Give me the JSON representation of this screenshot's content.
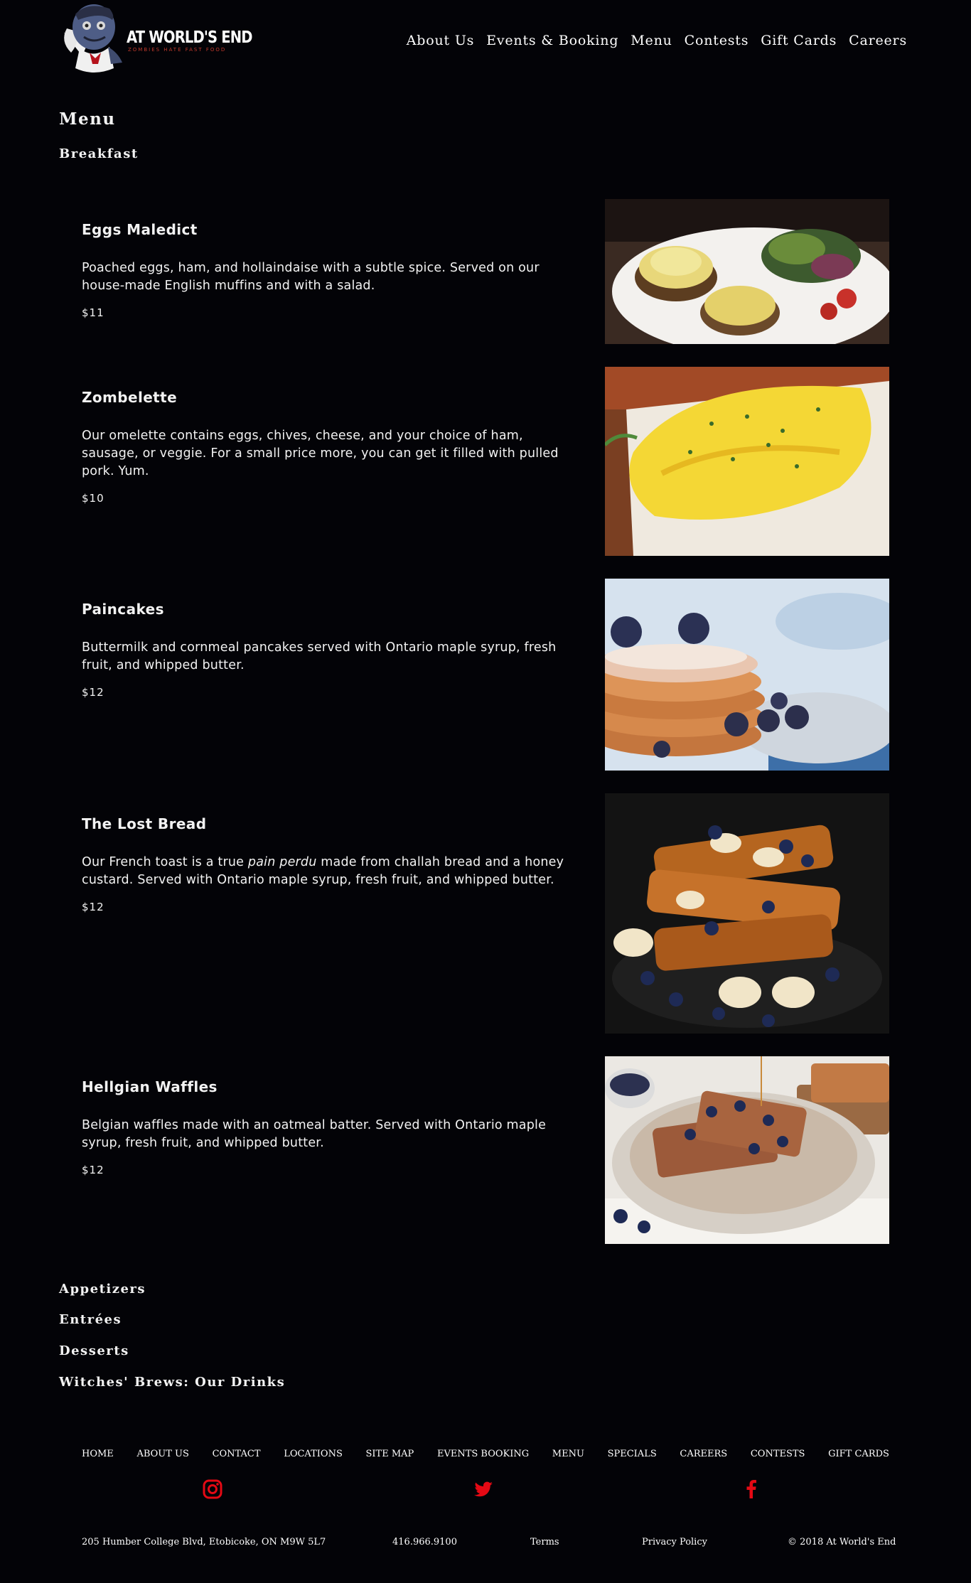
{
  "brand": {
    "name": "AT WORLD'S END",
    "tagline": "ZOMBIES HATE FAST FOOD"
  },
  "nav": [
    "About Us",
    "Events & Booking",
    "Menu",
    "Contests",
    "Gift Cards",
    "Careers"
  ],
  "page": {
    "title": "Menu",
    "section": "Breakfast"
  },
  "items": [
    {
      "name": "Eggs Maledict",
      "desc": "Poached eggs, ham, and hollaindaise with a subtle spice. Served on our house-made English muffins and with a salad.",
      "price": "$11",
      "image": "eggs-benedict-photo"
    },
    {
      "name": "Zombelette",
      "desc": "Our omelette contains eggs, chives, cheese, and your choice of ham, sausage, or veggie. For a small price more, you can get it filled with pulled pork. Yum.",
      "price": "$10",
      "image": "omelette-photo"
    },
    {
      "name": "Paincakes",
      "desc": "Buttermilk and cornmeal pancakes served with Ontario maple syrup, fresh fruit, and whipped butter.",
      "price": "$12",
      "image": "pancakes-photo"
    },
    {
      "name": "The Lost Bread",
      "desc_before": "Our French toast is a true ",
      "desc_italic": "pain perdu",
      "desc_after": " made from challah bread and a honey custard. Served with Ontario maple syrup, fresh fruit, and whipped butter.",
      "price": "$12",
      "image": "french-toast-photo"
    },
    {
      "name": "Hellgian Waffles",
      "desc": "Belgian waffles made with an oatmeal batter. Served with Ontario maple syrup, fresh fruit, and whipped butter.",
      "price": "$12",
      "image": "waffles-photo"
    }
  ],
  "categories": [
    "Appetizers",
    "Entrées",
    "Desserts",
    "Witches' Brews: Our Drinks"
  ],
  "footer": {
    "links": [
      "HOME",
      "ABOUT US",
      "CONTACT",
      "LOCATIONS",
      "SITE MAP",
      "EVENTS BOOKING",
      "MENU",
      "SPECIALS",
      "CAREERS",
      "CONTESTS",
      "GIFT CARDS"
    ],
    "social": [
      "instagram-icon",
      "twitter-icon",
      "facebook-icon"
    ],
    "address": "205 Humber College Blvd, Etobicoke, ON M9W 5L7",
    "phone": "416.966.9100",
    "terms": "Terms",
    "privacy": "Privacy Policy",
    "copyright": "© 2018 At World's End"
  },
  "colors": {
    "background": "#030307",
    "accent": "#e50914",
    "text": "#f2f2f2"
  }
}
